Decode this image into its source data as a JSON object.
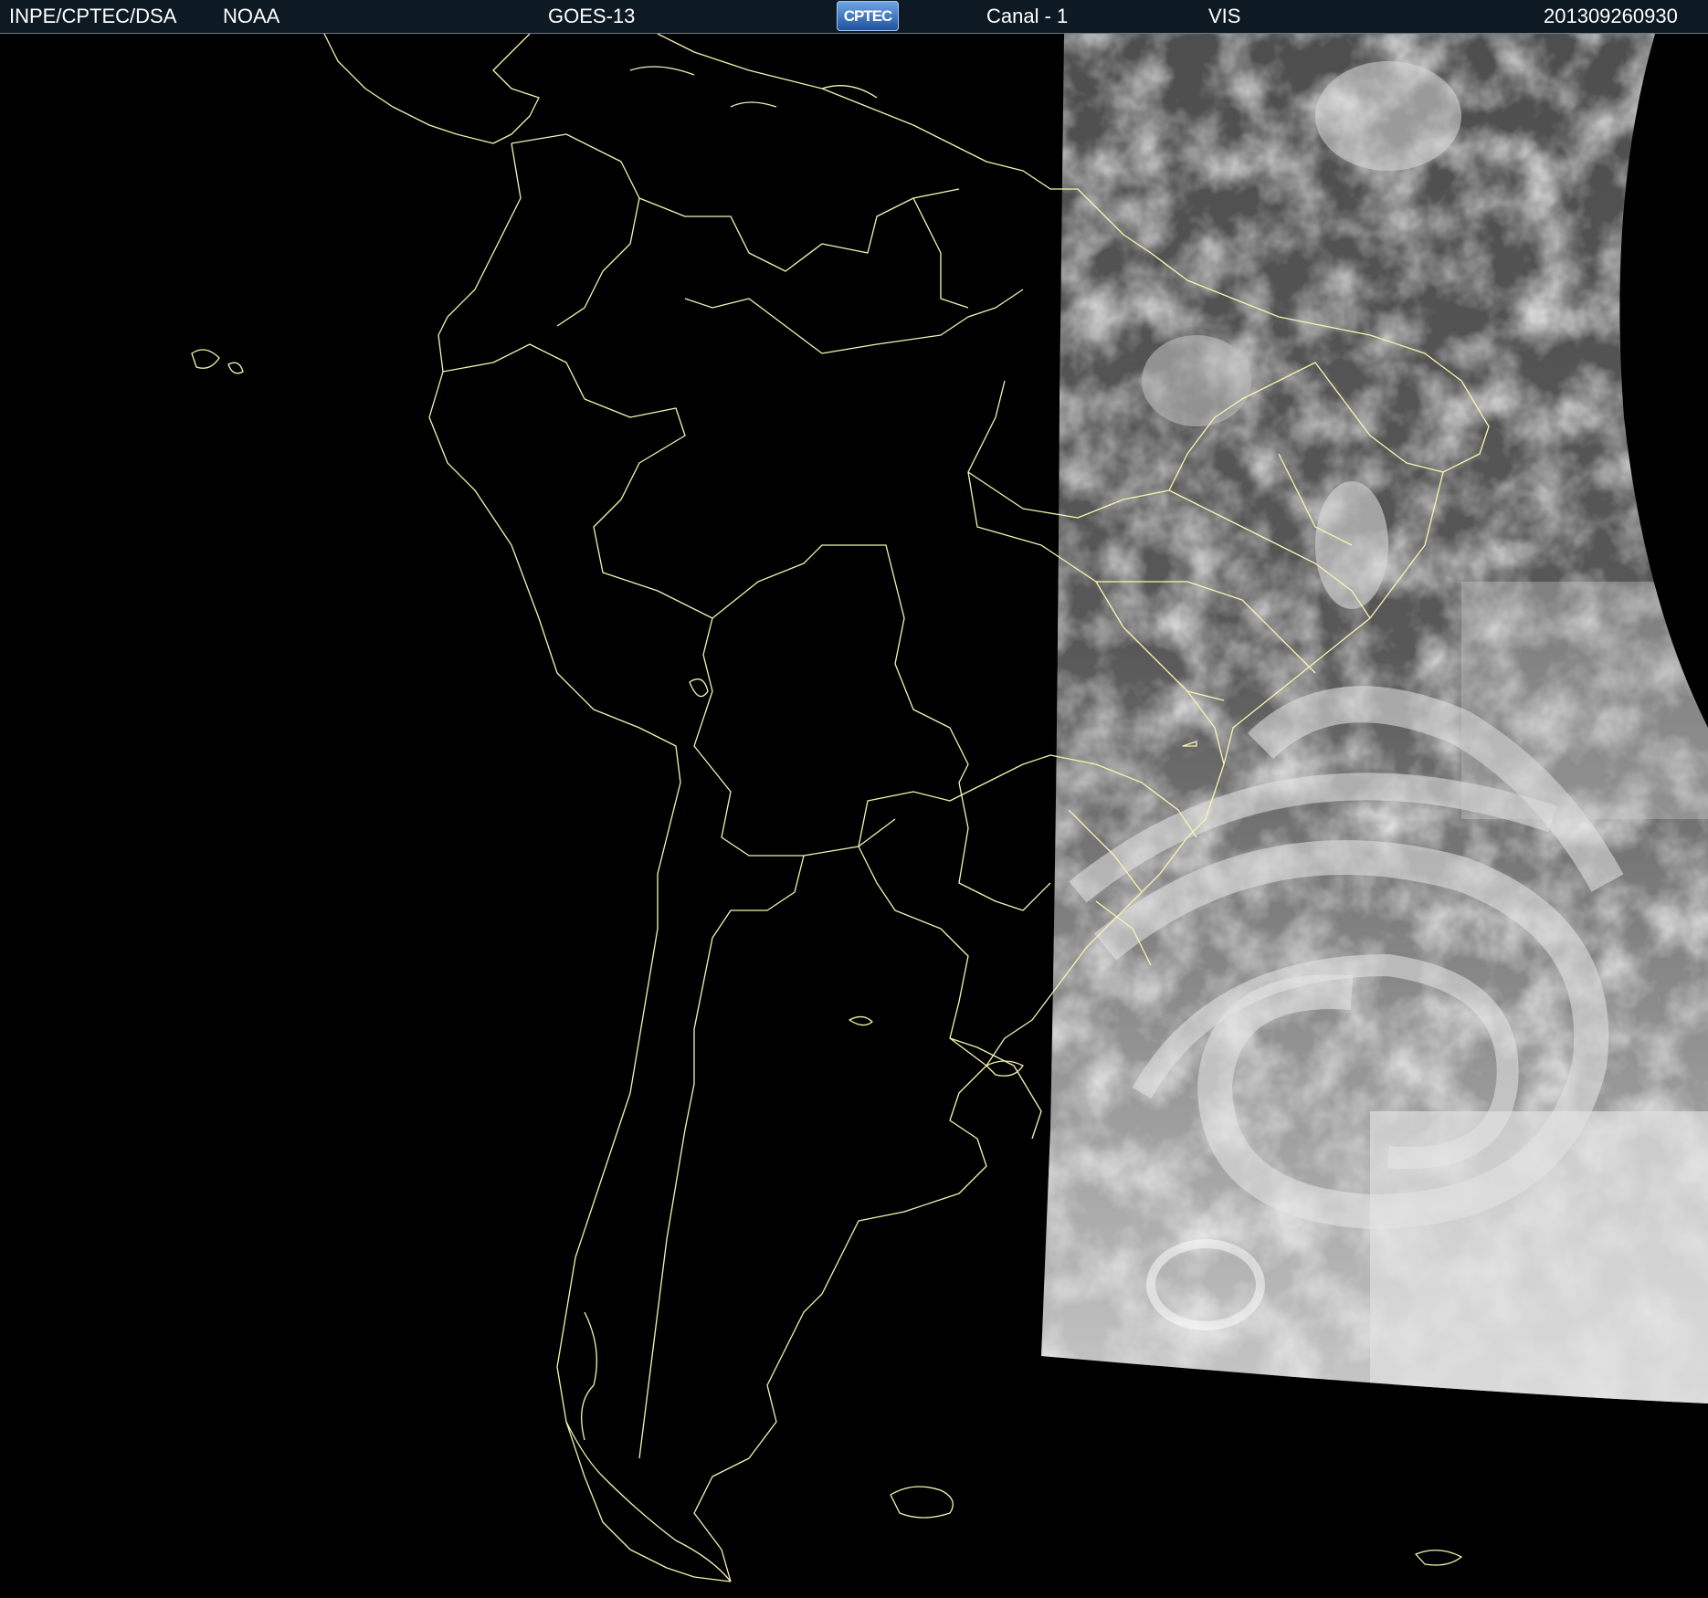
{
  "header": {
    "institution": "INPE/CPTEC/DSA",
    "agency": "NOAA",
    "satellite": "GOES-13",
    "logo_text": "CPTEC",
    "channel": "Canal - 1",
    "band": "VIS",
    "timestamp": "201309260930"
  },
  "map": {
    "border_color": "#f5f5b0",
    "background_color": "#000000",
    "cloud_color": "#dcdcdc",
    "ocean_image_color": "#5a5a5a"
  }
}
